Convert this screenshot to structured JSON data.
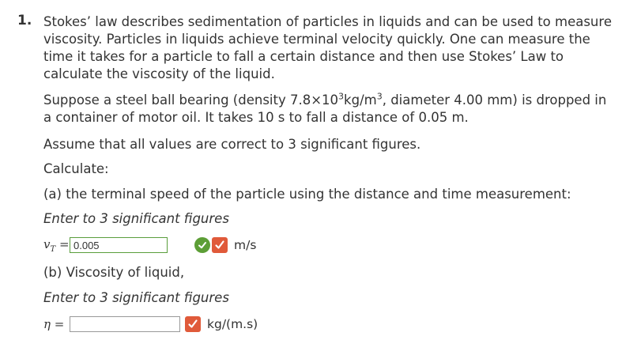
{
  "question": {
    "number": "1.",
    "intro": "Stokes’ law describes sedimentation of particles in liquids and can be used to measure viscosity. Particles in liquids achieve terminal velocity quickly. One can measure the time it takes for a particle to fall a certain distance and then use Stokes’ Law to calculate the viscosity of the liquid.",
    "setup_pre": "Suppose a steel ball bearing (density 7.8×10",
    "setup_exp1": "3",
    "setup_mid": "kg/m",
    "setup_exp2": "3",
    "setup_post": ", diameter 4.00 mm) is dropped in a container of motor oil. It takes 10 s to fall a distance of 0.05 m.",
    "assumption": "Assume that all values are correct to 3 significant figures.",
    "calculate": "Calculate:"
  },
  "part_a": {
    "prompt": "(a) the terminal speed of the particle using the distance and time measurement:",
    "hint": "Enter to 3 significant figures",
    "var_symbol": "v",
    "var_sub": "T",
    "equals": "=",
    "value": "0.005",
    "status_correct": true,
    "unit": "m/s"
  },
  "part_b": {
    "prompt": "(b) Viscosity of liquid,",
    "hint": "Enter to 3 significant figures",
    "var_symbol": "η",
    "equals": "=",
    "value": "",
    "unit": "kg/(m.s)"
  },
  "colors": {
    "correct_green": "#5c9e36",
    "mark_red": "#e05a3a",
    "text": "#333333"
  }
}
